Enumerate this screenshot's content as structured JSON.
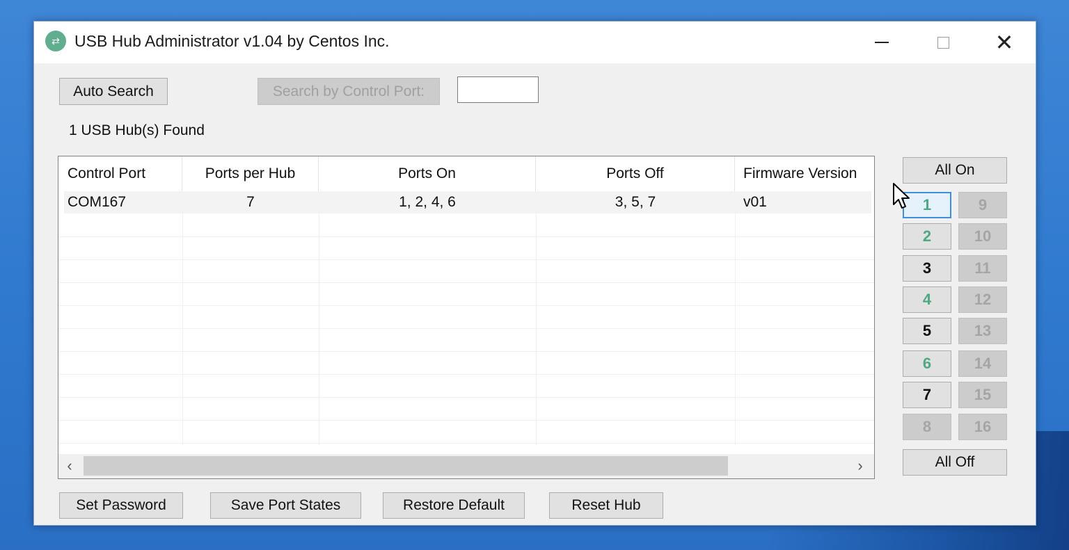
{
  "window": {
    "title": "USB Hub Administrator v1.04 by Centos Inc.",
    "app_icon": "usb-hub-icon",
    "controls": {
      "minimize": "minimize-icon",
      "maximize": "maximize-icon",
      "close": "close-icon",
      "close_glyph": "✕"
    }
  },
  "toolbar": {
    "auto_search_label": "Auto Search",
    "search_by_port_label": "Search by Control Port:",
    "control_port_value": ""
  },
  "status": {
    "found_text": "1 USB Hub(s) Found"
  },
  "table": {
    "columns": [
      "Control Port",
      "Ports per Hub",
      "Ports On",
      "Ports Off",
      "Firmware Version"
    ],
    "rows": [
      {
        "control_port": "COM167",
        "ports_per_hub": "7",
        "ports_on": "1, 2, 4, 6",
        "ports_off": "3, 5, 7",
        "firmware": "v01"
      }
    ]
  },
  "ports": {
    "all_on_label": "All On",
    "all_off_label": "All Off",
    "buttons": [
      {
        "label": "1",
        "state": "on"
      },
      {
        "label": "2",
        "state": "on"
      },
      {
        "label": "3",
        "state": "off"
      },
      {
        "label": "4",
        "state": "on"
      },
      {
        "label": "5",
        "state": "off"
      },
      {
        "label": "6",
        "state": "on"
      },
      {
        "label": "7",
        "state": "off"
      },
      {
        "label": "8",
        "state": "disabled"
      },
      {
        "label": "9",
        "state": "disabled"
      },
      {
        "label": "10",
        "state": "disabled"
      },
      {
        "label": "11",
        "state": "disabled"
      },
      {
        "label": "12",
        "state": "disabled"
      },
      {
        "label": "13",
        "state": "disabled"
      },
      {
        "label": "14",
        "state": "disabled"
      },
      {
        "label": "15",
        "state": "disabled"
      },
      {
        "label": "16",
        "state": "disabled"
      }
    ],
    "on_color": "#4fa882"
  },
  "footer": {
    "set_password_label": "Set Password",
    "save_port_states_label": "Save Port States",
    "restore_default_label": "Restore Default",
    "reset_hub_label": "Reset Hub"
  },
  "scrollbar": {
    "left_glyph": "‹",
    "right_glyph": "›"
  }
}
